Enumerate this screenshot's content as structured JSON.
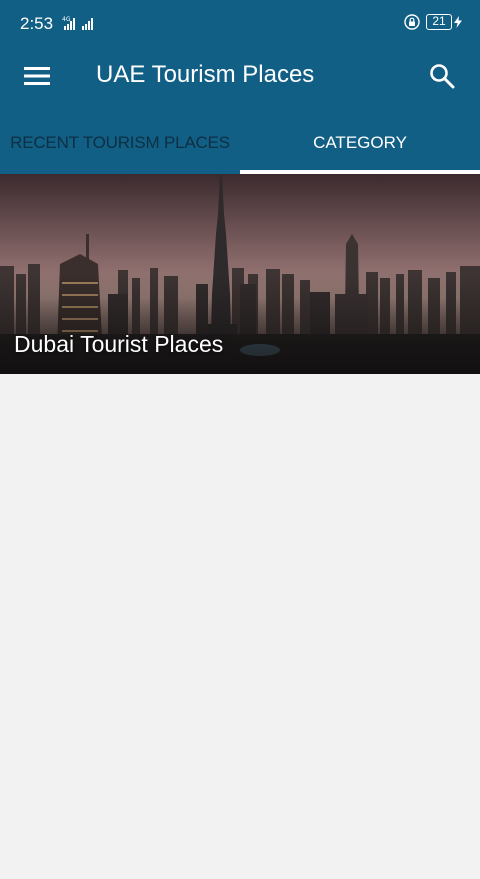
{
  "status_bar": {
    "time": "2:53",
    "battery_level": "21",
    "icons": [
      "signal-icon",
      "lock-rotation-icon",
      "battery-icon",
      "charging-icon"
    ]
  },
  "toolbar": {
    "title": "UAE Tourism Places",
    "icons": [
      "menu-icon",
      "search-icon"
    ]
  },
  "tabs": [
    {
      "label": "RECENT TOURISM PLACES",
      "selected": false
    },
    {
      "label": "CATEGORY",
      "selected": true
    }
  ],
  "categories": [
    {
      "title": "Dubai Tourist Places"
    }
  ],
  "colors": {
    "primary": "#125f86",
    "inactive_tab_text": "#0d2f42",
    "background": "#f2f2f2",
    "on_primary": "#ffffff"
  }
}
